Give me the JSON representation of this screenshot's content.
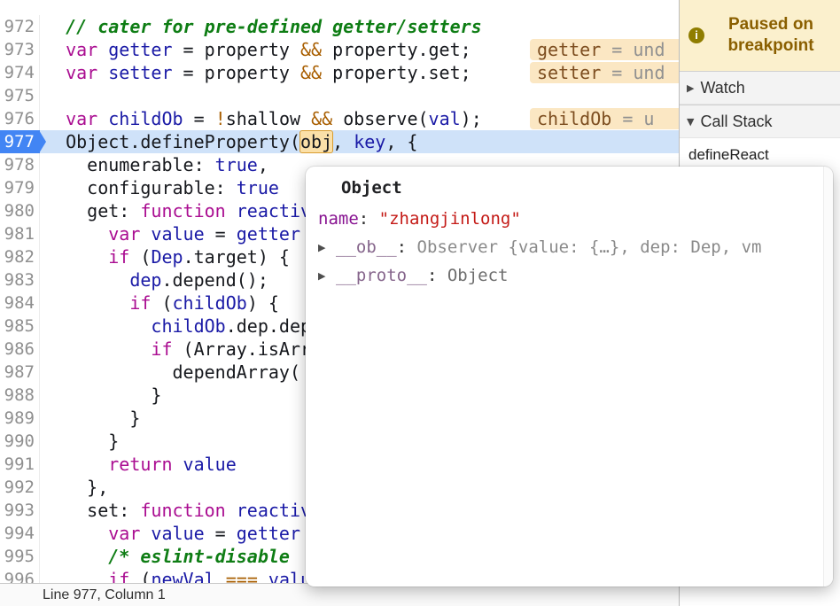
{
  "colors": {
    "keyword": "#aa0d91",
    "variable": "#1a1aa6",
    "comment": "#0e7d14",
    "operator": "#a85e00",
    "string": "#c41a16",
    "property_name": "#881391",
    "current_line": "#cfe2f9",
    "execution_marker": "#4285f4",
    "paused_banner_bg": "#fbf0cd",
    "paused_banner_text": "#8a5f00",
    "inline_value_bg": "#fbe7c3"
  },
  "icons": {
    "collapsed": "▶",
    "expanded": "▼",
    "info": "i"
  },
  "editor": {
    "status": "Line 977, Column 1",
    "lines": [
      {
        "num": "972",
        "tokens": [
          {
            "c": "pln",
            "t": "  "
          },
          {
            "c": "com",
            "t": "// cater for pre-defined getter/setters"
          }
        ]
      },
      {
        "num": "973",
        "tokens": [
          {
            "c": "pln",
            "t": "  "
          },
          {
            "c": "kw",
            "t": "var"
          },
          {
            "c": "pln",
            "t": " "
          },
          {
            "c": "var",
            "t": "getter"
          },
          {
            "c": "pln",
            "t": " = property "
          },
          {
            "c": "op",
            "t": "&&"
          },
          {
            "c": "pln",
            "t": " property.get;"
          }
        ],
        "badge": {
          "name": "getter",
          "rest": " = und"
        }
      },
      {
        "num": "974",
        "tokens": [
          {
            "c": "pln",
            "t": "  "
          },
          {
            "c": "kw",
            "t": "var"
          },
          {
            "c": "pln",
            "t": " "
          },
          {
            "c": "var",
            "t": "setter"
          },
          {
            "c": "pln",
            "t": " = property "
          },
          {
            "c": "op",
            "t": "&&"
          },
          {
            "c": "pln",
            "t": " property.set;"
          }
        ],
        "badge": {
          "name": "setter",
          "rest": " = und"
        }
      },
      {
        "num": "975",
        "tokens": []
      },
      {
        "num": "976",
        "tokens": [
          {
            "c": "pln",
            "t": "  "
          },
          {
            "c": "kw",
            "t": "var"
          },
          {
            "c": "pln",
            "t": " "
          },
          {
            "c": "var",
            "t": "childOb"
          },
          {
            "c": "pln",
            "t": " = "
          },
          {
            "c": "op",
            "t": "!"
          },
          {
            "c": "pln",
            "t": "shallow "
          },
          {
            "c": "op",
            "t": "&&"
          },
          {
            "c": "pln",
            "t": " observe("
          },
          {
            "c": "var",
            "t": "val"
          },
          {
            "c": "pln",
            "t": ");"
          }
        ],
        "badge": {
          "name": "childOb",
          "rest": " = u"
        }
      },
      {
        "num": "977",
        "current": true,
        "tokens": [
          {
            "c": "pln",
            "t": "  Object.defineProperty("
          },
          {
            "c": "hl",
            "t": "obj"
          },
          {
            "c": "pln",
            "t": ", "
          },
          {
            "c": "var",
            "t": "key"
          },
          {
            "c": "pln",
            "t": ", {"
          }
        ]
      },
      {
        "num": "978",
        "tokens": [
          {
            "c": "pln",
            "t": "    enumerable: "
          },
          {
            "c": "var",
            "t": "true"
          },
          {
            "c": "pln",
            "t": ","
          }
        ]
      },
      {
        "num": "979",
        "tokens": [
          {
            "c": "pln",
            "t": "    configurable: "
          },
          {
            "c": "var",
            "t": "true"
          }
        ]
      },
      {
        "num": "980",
        "tokens": [
          {
            "c": "pln",
            "t": "    get: "
          },
          {
            "c": "kw",
            "t": "function"
          },
          {
            "c": "pln",
            "t": " "
          },
          {
            "c": "var",
            "t": "reactiveGe"
          }
        ]
      },
      {
        "num": "981",
        "tokens": [
          {
            "c": "pln",
            "t": "      "
          },
          {
            "c": "kw",
            "t": "var"
          },
          {
            "c": "pln",
            "t": " "
          },
          {
            "c": "var",
            "t": "value"
          },
          {
            "c": "pln",
            "t": " = "
          },
          {
            "c": "var",
            "t": "getter"
          }
        ]
      },
      {
        "num": "982",
        "tokens": [
          {
            "c": "pln",
            "t": "      "
          },
          {
            "c": "kw",
            "t": "if"
          },
          {
            "c": "pln",
            "t": " ("
          },
          {
            "c": "var",
            "t": "Dep"
          },
          {
            "c": "pln",
            "t": ".target) {"
          }
        ]
      },
      {
        "num": "983",
        "tokens": [
          {
            "c": "pln",
            "t": "        "
          },
          {
            "c": "var",
            "t": "dep"
          },
          {
            "c": "pln",
            "t": ".depend();"
          }
        ]
      },
      {
        "num": "984",
        "tokens": [
          {
            "c": "pln",
            "t": "        "
          },
          {
            "c": "kw",
            "t": "if"
          },
          {
            "c": "pln",
            "t": " ("
          },
          {
            "c": "var",
            "t": "childOb"
          },
          {
            "c": "pln",
            "t": ") {"
          }
        ]
      },
      {
        "num": "985",
        "tokens": [
          {
            "c": "pln",
            "t": "          "
          },
          {
            "c": "var",
            "t": "childOb"
          },
          {
            "c": "pln",
            "t": ".dep.depe"
          }
        ]
      },
      {
        "num": "986",
        "tokens": [
          {
            "c": "pln",
            "t": "          "
          },
          {
            "c": "kw",
            "t": "if"
          },
          {
            "c": "pln",
            "t": " (Array.isArr"
          }
        ]
      },
      {
        "num": "987",
        "tokens": [
          {
            "c": "pln",
            "t": "            dependArray("
          }
        ]
      },
      {
        "num": "988",
        "tokens": [
          {
            "c": "pln",
            "t": "          }"
          }
        ]
      },
      {
        "num": "989",
        "tokens": [
          {
            "c": "pln",
            "t": "        }"
          }
        ]
      },
      {
        "num": "990",
        "tokens": [
          {
            "c": "pln",
            "t": "      }"
          }
        ]
      },
      {
        "num": "991",
        "tokens": [
          {
            "c": "pln",
            "t": "      "
          },
          {
            "c": "kw",
            "t": "return"
          },
          {
            "c": "pln",
            "t": " "
          },
          {
            "c": "var",
            "t": "value"
          }
        ]
      },
      {
        "num": "992",
        "tokens": [
          {
            "c": "pln",
            "t": "    },"
          }
        ]
      },
      {
        "num": "993",
        "tokens": [
          {
            "c": "pln",
            "t": "    set: "
          },
          {
            "c": "kw",
            "t": "function"
          },
          {
            "c": "pln",
            "t": " "
          },
          {
            "c": "var",
            "t": "reactiveSe"
          }
        ]
      },
      {
        "num": "994",
        "tokens": [
          {
            "c": "pln",
            "t": "      "
          },
          {
            "c": "kw",
            "t": "var"
          },
          {
            "c": "pln",
            "t": " "
          },
          {
            "c": "var",
            "t": "value"
          },
          {
            "c": "pln",
            "t": " = "
          },
          {
            "c": "var",
            "t": "getter"
          }
        ]
      },
      {
        "num": "995",
        "tokens": [
          {
            "c": "pln",
            "t": "      "
          },
          {
            "c": "com",
            "t": "/* eslint-disable"
          }
        ]
      },
      {
        "num": "996",
        "tokens": [
          {
            "c": "pln",
            "t": "      "
          },
          {
            "c": "kw",
            "t": "if"
          },
          {
            "c": "pln",
            "t": " ("
          },
          {
            "c": "var",
            "t": "newVal"
          },
          {
            "c": "pln",
            "t": " "
          },
          {
            "c": "op",
            "t": "==="
          },
          {
            "c": "pln",
            "t": " "
          },
          {
            "c": "var",
            "t": "value"
          }
        ]
      }
    ]
  },
  "sidebar": {
    "paused_banner": "Paused on breakpoint",
    "sections": {
      "watch": {
        "label": "Watch"
      },
      "call_stack": {
        "label": "Call Stack"
      }
    },
    "call_stack_frames": [
      "defineReact"
    ]
  },
  "popup": {
    "title": "Object",
    "properties": [
      {
        "name": "name",
        "value": "\"zhangjinlong\"",
        "type": "string",
        "expandable": false,
        "internal": false
      },
      {
        "name": "__ob__",
        "value": "Observer {value: {…}, dep: Dep, vm",
        "type": "preview",
        "expandable": true,
        "internal": true
      },
      {
        "name": "__proto__",
        "value": "Object",
        "type": "object",
        "expandable": true,
        "internal": true
      }
    ]
  }
}
